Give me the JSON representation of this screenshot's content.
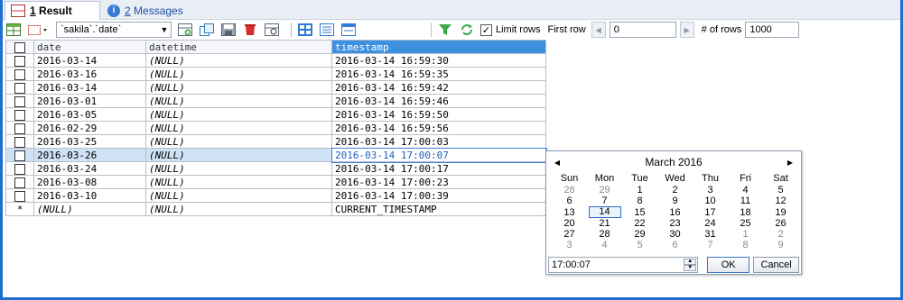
{
  "tabs": [
    {
      "num": "1",
      "label": "Result",
      "active": true
    },
    {
      "num": "2",
      "label": "Messages",
      "active": false
    }
  ],
  "toolbar": {
    "table_select": "`sakila`.`date`",
    "limit_rows_label": "Limit rows",
    "limit_rows_checked": true,
    "first_row_label": "First row",
    "first_row_value": "0",
    "num_rows_label": "# of rows",
    "num_rows_value": "1000"
  },
  "grid": {
    "columns": [
      "date",
      "datetime",
      "timestamp"
    ],
    "rows": [
      {
        "date": "2016-03-14",
        "datetime": "(NULL)",
        "timestamp": "2016-03-14 16:59:30"
      },
      {
        "date": "2016-03-16",
        "datetime": "(NULL)",
        "timestamp": "2016-03-14 16:59:35"
      },
      {
        "date": "2016-03-14",
        "datetime": "(NULL)",
        "timestamp": "2016-03-14 16:59:42"
      },
      {
        "date": "2016-03-01",
        "datetime": "(NULL)",
        "timestamp": "2016-03-14 16:59:46"
      },
      {
        "date": "2016-03-05",
        "datetime": "(NULL)",
        "timestamp": "2016-03-14 16:59:50"
      },
      {
        "date": "2016-02-29",
        "datetime": "(NULL)",
        "timestamp": "2016-03-14 16:59:56"
      },
      {
        "date": "2016-03-25",
        "datetime": "(NULL)",
        "timestamp": "2016-03-14 17:00:03"
      },
      {
        "date": "2016-03-26",
        "datetime": "(NULL)",
        "timestamp": "2016-03-14 17:00:07"
      },
      {
        "date": "2016-03-24",
        "datetime": "(NULL)",
        "timestamp": "2016-03-14 17:00:17"
      },
      {
        "date": "2016-03-08",
        "datetime": "(NULL)",
        "timestamp": "2016-03-14 17:00:23"
      },
      {
        "date": "2016-03-10",
        "datetime": "(NULL)",
        "timestamp": "2016-03-14 17:00:39"
      }
    ],
    "new_row": {
      "marker": "*",
      "date": "(NULL)",
      "datetime": "(NULL)",
      "timestamp": "CURRENT_TIMESTAMP"
    },
    "selected_row_index": 7
  },
  "calendar": {
    "month_label": "March 2016",
    "weekdays": [
      "Sun",
      "Mon",
      "Tue",
      "Wed",
      "Thu",
      "Fri",
      "Sat"
    ],
    "weeks": [
      [
        "28",
        "29",
        "1",
        "2",
        "3",
        "4",
        "5"
      ],
      [
        "6",
        "7",
        "8",
        "9",
        "10",
        "11",
        "12"
      ],
      [
        "13",
        "14",
        "15",
        "16",
        "17",
        "18",
        "19"
      ],
      [
        "20",
        "21",
        "22",
        "23",
        "24",
        "25",
        "26"
      ],
      [
        "27",
        "28",
        "29",
        "30",
        "31",
        "1",
        "2"
      ],
      [
        "3",
        "4",
        "5",
        "6",
        "7",
        "8",
        "9"
      ]
    ],
    "today": "14",
    "time_value": "17:00:07",
    "ok_label": "OK",
    "cancel_label": "Cancel"
  },
  "colors": {
    "accent": "#3d8fe0",
    "selection": "#cfe2f5",
    "frame": "#1f6fcf"
  }
}
